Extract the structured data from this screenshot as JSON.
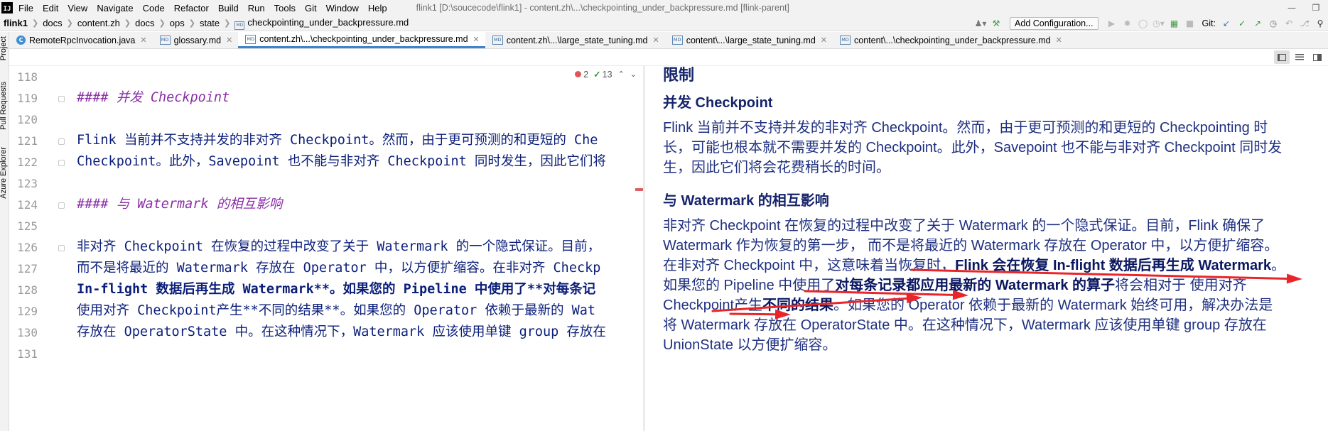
{
  "menubar": {
    "logo_text": "IJ",
    "items": [
      "File",
      "Edit",
      "View",
      "Navigate",
      "Code",
      "Refactor",
      "Build",
      "Run",
      "Tools",
      "Git",
      "Window",
      "Help"
    ],
    "window_title": "flink1 [D:\\soucecode\\flink1] - content.zh\\...\\checkpointing_under_backpressure.md [flink-parent]"
  },
  "breadcrumb": {
    "root": "flink1",
    "parts": [
      "docs",
      "content.zh",
      "docs",
      "ops",
      "state"
    ],
    "file_icon_text": "MD",
    "file": "checkpointing_under_backpressure.md"
  },
  "toolbar": {
    "add_configuration_label": "Add Configuration...",
    "git_label": "Git:"
  },
  "tool_windows": {
    "project_label": "Project",
    "pull_requests_label": "Pull Requests",
    "azure_label": "Azure Explorer"
  },
  "tabs": [
    {
      "label": "RemoteRpcInvocation.java",
      "icon": "java-class-icon",
      "active": false
    },
    {
      "label": "glossary.md",
      "icon": "markdown-file-icon",
      "active": false
    },
    {
      "label": "content.zh\\...\\checkpointing_under_backpressure.md",
      "icon": "markdown-file-icon",
      "active": true
    },
    {
      "label": "content.zh\\...\\large_state_tuning.md",
      "icon": "markdown-file-icon",
      "active": false
    },
    {
      "label": "content\\...\\large_state_tuning.md",
      "icon": "markdown-file-icon",
      "active": false
    },
    {
      "label": "content\\...\\checkpointing_under_backpressure.md",
      "icon": "markdown-file-icon",
      "active": false
    }
  ],
  "inspection": {
    "errors": "2",
    "weak_warnings": "13"
  },
  "editor": {
    "line_numbers": [
      "118",
      "119",
      "120",
      "121",
      "122",
      "123",
      "124",
      "125",
      "126",
      "127",
      "128",
      "129",
      "130",
      "131"
    ],
    "lines": [
      "",
      "#### 并发 Checkpoint",
      "",
      "Flink 当前并不支持并发的非对齐 Checkpoint。然而，由于更可预测的和更短的 Che",
      "Checkpoint。此外，Savepoint 也不能与非对齐 Checkpoint 同时发生，因此它们将",
      "",
      "#### 与 Watermark 的相互影响",
      "",
      "非对齐 Checkpoint 在恢复的过程中改变了关于 Watermark 的一个隐式保证。目前，",
      "而不是将最近的 Watermark 存放在 Operator 中，以方便扩缩容。在非对齐 Checkp",
      "In-flight 数据后再生成 Watermark**。如果您的 Pipeline 中使用了**对每条记",
      "使用对齐 Checkpoint产生**不同的结果**。如果您的 Operator 依赖于最新的 Wat",
      "存放在 OperatorState 中。在这种情况下，Watermark 应该使用单键 group 存放在",
      ""
    ]
  },
  "preview": {
    "partial_heading": "限制",
    "h_concurrent": "并发 Checkpoint",
    "p1_line1": "Flink 当前并不支持并发的非对齐 Checkpoint。然而，由于更可预测的和更短的 Checkpointing 时",
    "p1_line2": "长，可能也根本就不需要并发的 Checkpoint。此外，Savepoint 也不能与非对齐 Checkpoint 同时发",
    "p1_line3": "生，因此它们将会花费稍长的时间。",
    "h_watermark": "与 Watermark 的相互影响",
    "p2_line1": "非对齐 Checkpoint 在恢复的过程中改变了关于 Watermark 的一个隐式保证。目前，Flink 确保了",
    "p2_line2": "Watermark 作为恢复的第一步， 而不是将最近的 Watermark 存放在 Operator 中，以方便扩缩容。",
    "p2_line3_a": "在非对齐 Checkpoint 中，这意味着当恢复时，",
    "p2_line3_b": "Flink 会在恢复 In-flight 数据后再生成 Watermark",
    "p2_line3_c": "。",
    "p2_line4_a": "如果您的 Pipeline 中使用了",
    "p2_line4_b": "对每条记录都应用最新的 Watermark 的算子",
    "p2_line4_c": "将会相对于 使用对齐",
    "p2_line5_a": "Checkpoint产生",
    "p2_line5_b": "不同的结果",
    "p2_line5_c": "。如果您的 Operator 依赖于最新的 Watermark 始终可用，解决办法是",
    "p2_line6": "将 Watermark 存放在 OperatorState 中。在这种情况下，Watermark 应该使用单键 group 存放在",
    "p2_line7": "UnionState 以方便扩缩容。"
  },
  "colors": {
    "annotation_arrow": "#e8262a",
    "heading_markdown": "#8a2ea6",
    "code_text": "#0b1f7a",
    "active_tab_underline": "#4083c9"
  }
}
